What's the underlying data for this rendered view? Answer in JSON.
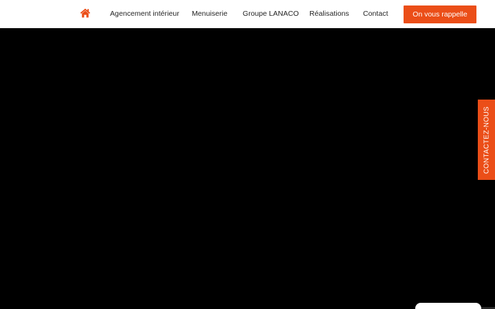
{
  "header": {
    "home_icon": "home-icon",
    "nav": {
      "agencement": "Agencement intérieur",
      "menuiserie": "Menuiserie",
      "groupe": "Groupe LANACO",
      "realisations": "Réalisations",
      "contact": "Contact"
    },
    "cta_label": "On vous rappelle"
  },
  "side_tab": {
    "label": "CONTACTEZ-NOUS"
  },
  "colors": {
    "accent": "#eb4e18",
    "hero_background": "#000000",
    "header_background": "#ffffff",
    "nav_text": "#222222"
  }
}
